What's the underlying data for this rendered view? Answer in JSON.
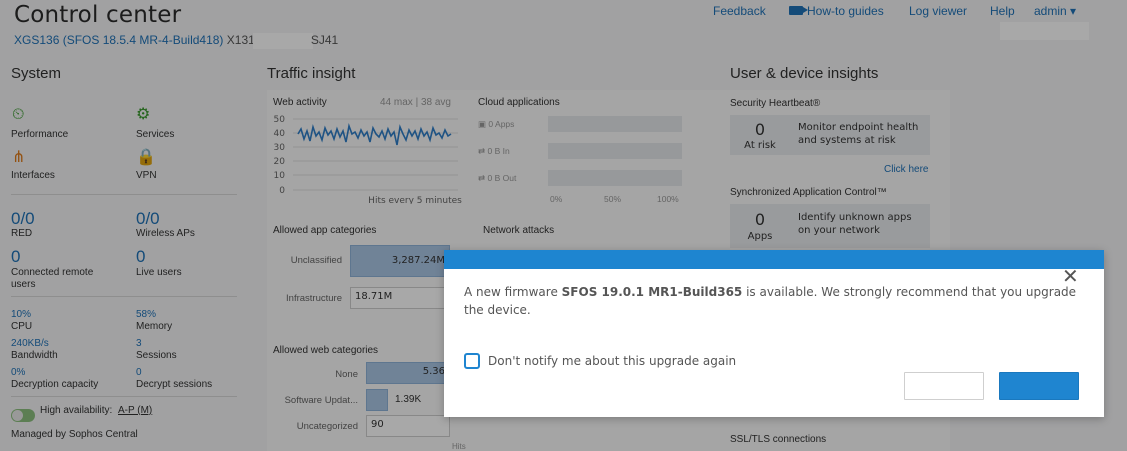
{
  "header": {
    "title": "Control center",
    "device_model": "XGS136 (SFOS 18.5.4 MR-4-Build418)",
    "serial_prefix": "X131",
    "serial_suffix": "SJ41",
    "nav": {
      "feedback": "Feedback",
      "howto": "How-to guides",
      "log_viewer": "Log viewer",
      "help": "Help",
      "admin": "admin ▾"
    }
  },
  "system": {
    "title": "System",
    "icons": [
      {
        "label": "Performance",
        "icon": "performance-icon"
      },
      {
        "label": "Services",
        "icon": "services-gear-icon"
      },
      {
        "label": "Interfaces",
        "icon": "interfaces-icon"
      },
      {
        "label": "VPN",
        "icon": "vpn-lock-icon"
      }
    ],
    "red_value": "0/0",
    "red_label": "RED",
    "wireless_value": "0/0",
    "wireless_label": "Wireless APs",
    "remote_value": "0",
    "remote_label": "Connected remote users",
    "live_value": "0",
    "live_label": "Live users",
    "cpu_value": "10%",
    "cpu_label": "CPU",
    "memory_value": "58%",
    "memory_label": "Memory",
    "bandwidth_value": "240KB/s",
    "bandwidth_label": "Bandwidth",
    "sessions_value": "3",
    "sessions_label": "Sessions",
    "decrypt_cap_value": "0%",
    "decrypt_cap_label": "Decryption capacity",
    "decrypt_sess_value": "0",
    "decrypt_sess_label": "Decrypt sessions",
    "ha_label": "High availability:",
    "ha_value": "A-P (M)",
    "managed": "Managed by Sophos Central"
  },
  "traffic": {
    "title": "Traffic insight",
    "web_activity": {
      "title": "Web activity",
      "stats": "44 max | 38 avg",
      "y_ticks": [
        "50",
        "40",
        "30",
        "20",
        "10",
        "0"
      ],
      "caption": "Hits every 5 minutes"
    },
    "cloud": {
      "title": "Cloud applications",
      "rows": [
        "0 Apps",
        "0 B In",
        "0 B Out"
      ],
      "x_ticks": [
        "0%",
        "50%",
        "100%"
      ]
    },
    "app_categories": {
      "title": "Allowed app categories",
      "rows": [
        {
          "label": "Unclassified",
          "value": "3,287.24M"
        },
        {
          "label": "Infrastructure",
          "value": "18.71M"
        }
      ]
    },
    "network_attacks": {
      "title": "Network attacks"
    },
    "web_categories": {
      "title": "Allowed web categories",
      "rows": [
        {
          "label": "None",
          "value": "5.36"
        },
        {
          "label": "Software Updat...",
          "value": "1.39K"
        },
        {
          "label": "Uncategorized",
          "value": "90"
        }
      ],
      "axis_hint": "Hits"
    }
  },
  "user_device": {
    "title": "User & device insights",
    "heartbeat": {
      "title": "Security Heartbeat®",
      "value": "0",
      "label": "At risk",
      "desc": "Monitor endpoint health and systems at risk",
      "link": "Click here"
    },
    "sync_app": {
      "title": "Synchronized Application Control™",
      "value": "0",
      "label": "Apps",
      "desc": "Identify unknown apps on your network"
    },
    "ssl": {
      "title": "SSL/TLS connections"
    }
  },
  "modal": {
    "msg_prefix": "A new firmware ",
    "firmware": "SFOS 19.0.1 MR1-Build365",
    "msg_suffix": " is available. We strongly recommend that you upgrade the device.",
    "checkbox_label": "Don't notify me about this upgrade again",
    "checkbox_checked": false,
    "cancel_label": "",
    "primary_label": ""
  },
  "colors": {
    "accent": "#1f85d0",
    "link": "#1f72b8",
    "icon_green": "#3a9a2e",
    "icon_orange": "#e07b1a"
  }
}
